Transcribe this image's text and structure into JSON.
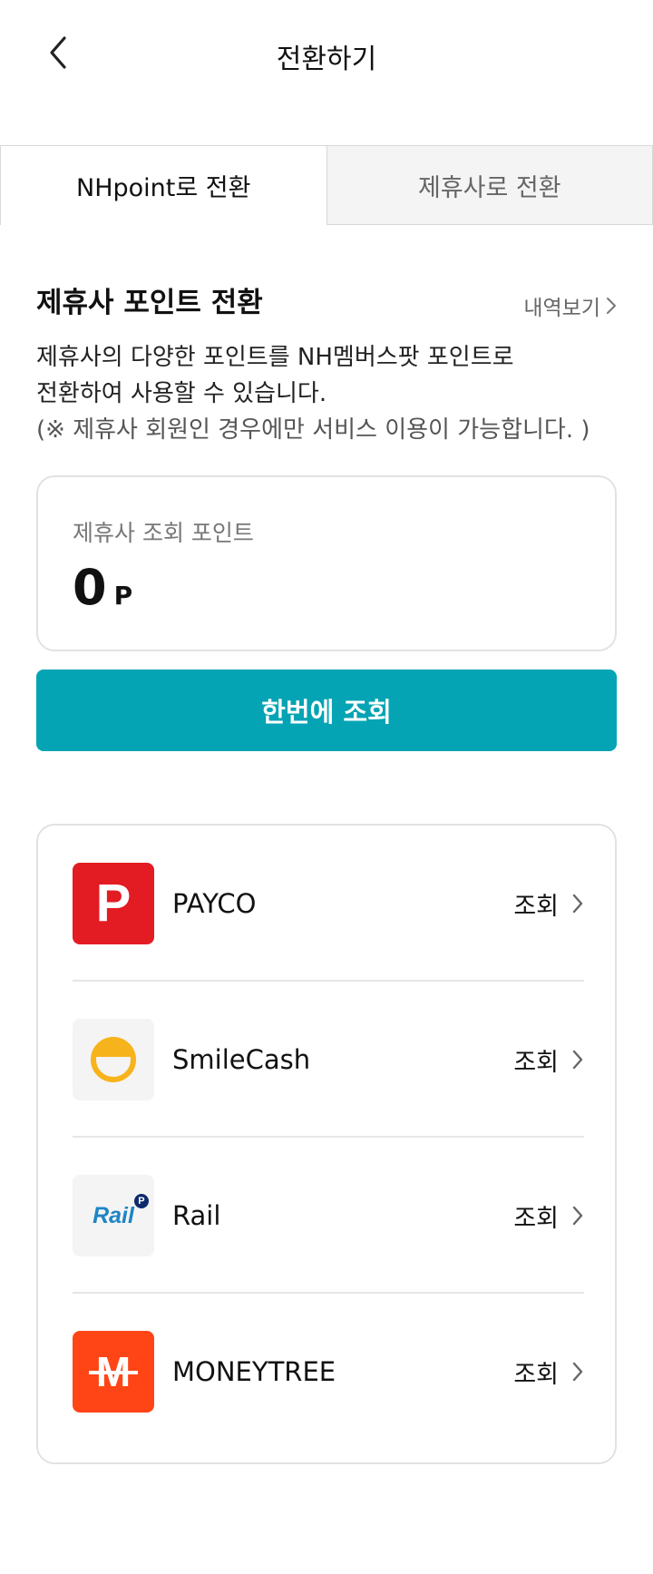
{
  "header": {
    "title": "전환하기"
  },
  "tabs": [
    {
      "label": "NHpoint로 전환"
    },
    {
      "label": "제휴사로 전환"
    }
  ],
  "section": {
    "title": "제휴사 포인트 전환",
    "history_link": "내역보기",
    "description_line1": "제휴사의 다양한 포인트를 NH멤버스팟 포인트로",
    "description_line2": "전환하여 사용할 수 있습니다.",
    "note": "(※ 제휴사 회원인 경우에만 서비스 이용이 가능합니다. )"
  },
  "points_card": {
    "label": "제휴사 조회 포인트",
    "value": "0",
    "unit": "P"
  },
  "lookup_all_button": "한번에 조회",
  "partners": [
    {
      "name": "PAYCO",
      "action": "조회",
      "logo_icon": "payco-logo",
      "logo_text": "P"
    },
    {
      "name": "SmileCash",
      "action": "조회",
      "logo_icon": "smilecash-logo"
    },
    {
      "name": "Rail",
      "action": "조회",
      "logo_icon": "rail-logo",
      "logo_text": "Rail"
    },
    {
      "name": "MONEYTREE",
      "action": "조회",
      "logo_icon": "moneytree-logo",
      "logo_text": "M"
    }
  ],
  "colors": {
    "accent": "#05a4b4",
    "payco": "#e31b23",
    "smilecash": "#f7b31b",
    "rail": "#1e84c6",
    "moneytree": "#ff4516"
  }
}
